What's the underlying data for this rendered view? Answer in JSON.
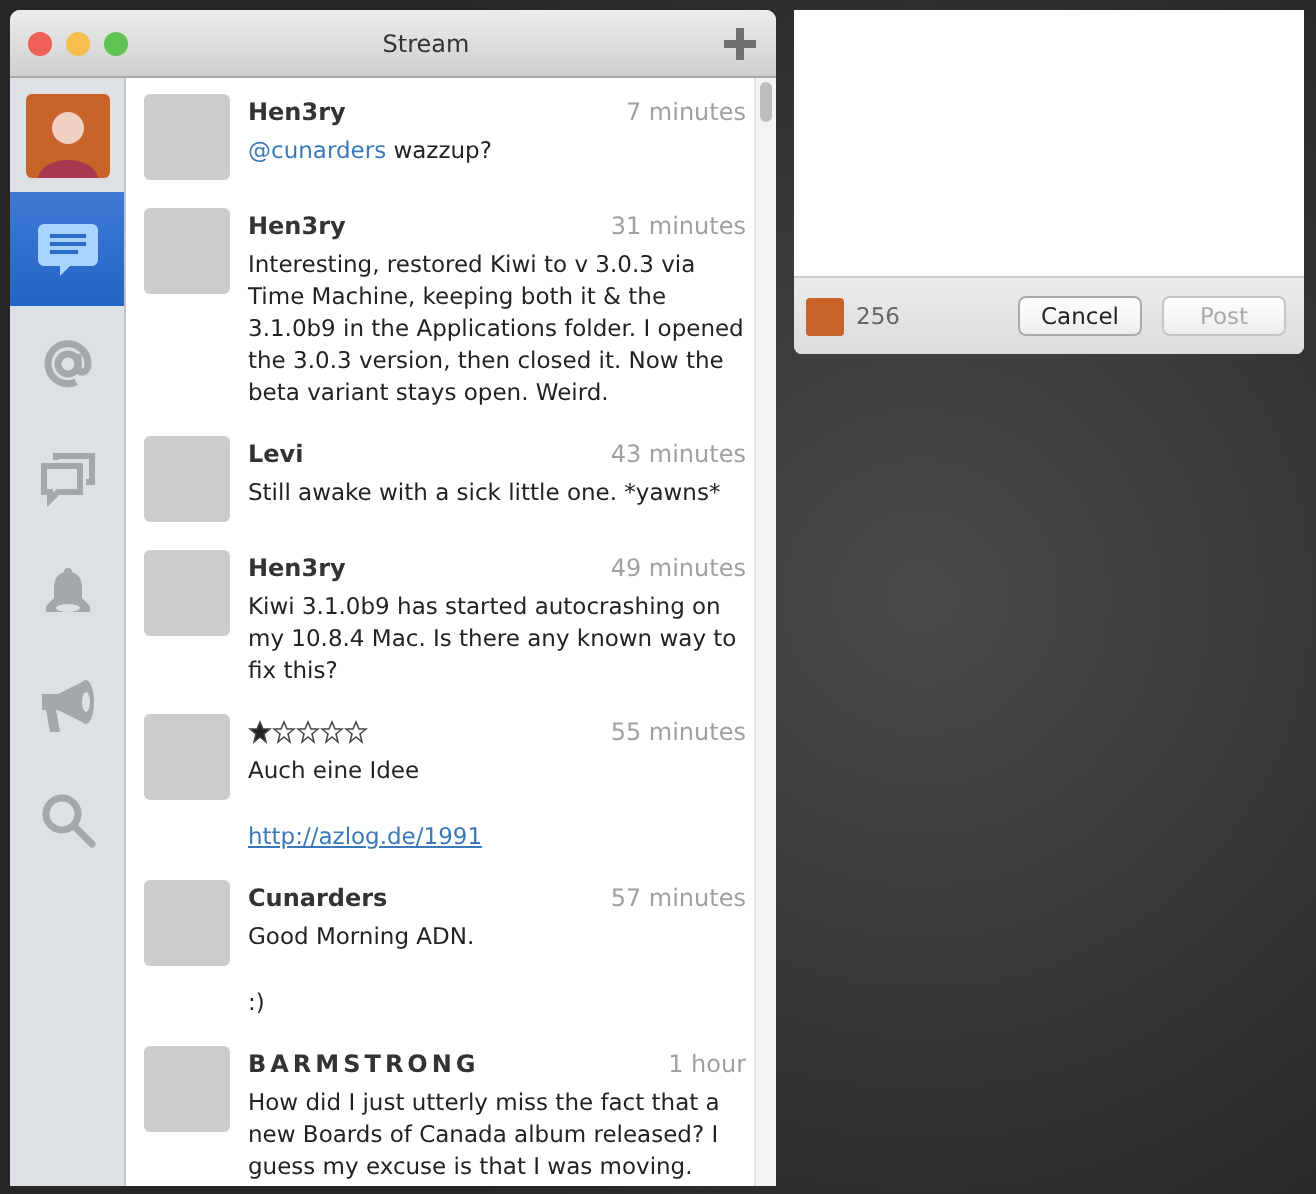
{
  "window": {
    "title": "Stream"
  },
  "sidebar": {
    "items": [
      {
        "kind": "profile",
        "selected": false
      },
      {
        "kind": "stream",
        "selected": true
      },
      {
        "kind": "mentions",
        "selected": false
      },
      {
        "kind": "messages",
        "selected": false
      },
      {
        "kind": "notifications",
        "selected": false
      },
      {
        "kind": "broadcast",
        "selected": false
      },
      {
        "kind": "search",
        "selected": false
      }
    ]
  },
  "posts": [
    {
      "kind": "name",
      "author": "Hen3ry",
      "time": "7 minutes",
      "paragraphs": [
        [
          {
            "kind": "mention",
            "text": "@cunarders"
          },
          {
            "kind": "text",
            "text": " wazzup?"
          }
        ]
      ]
    },
    {
      "kind": "name",
      "author": "Hen3ry",
      "time": "31 minutes",
      "paragraphs": [
        [
          {
            "kind": "text",
            "text": "Interesting, restored Kiwi to v 3.0.3 via Time Machine, keeping both it & the 3.1.0b9 in the Applications folder. I opened the 3.0.3 version, then closed it. Now the beta variant stays open. Weird."
          }
        ]
      ]
    },
    {
      "kind": "name",
      "author": "Levi",
      "time": "43 minutes",
      "paragraphs": [
        [
          {
            "kind": "text",
            "text": "Still awake with a sick little one. *yawns*"
          }
        ]
      ]
    },
    {
      "kind": "name",
      "author": "Hen3ry",
      "time": "49 minutes",
      "paragraphs": [
        [
          {
            "kind": "text",
            "text": "Kiwi 3.1.0b9 has started autocrashing on my 10.8.4 Mac. Is there any known way to fix this?"
          }
        ]
      ]
    },
    {
      "kind": "stars",
      "stars": 1,
      "time": "55 minutes",
      "paragraphs": [
        [
          {
            "kind": "text",
            "text": "Auch eine Idee"
          }
        ],
        [
          {
            "kind": "link",
            "text": "http://azlog.de/1991"
          }
        ]
      ]
    },
    {
      "kind": "name",
      "author": "Cunarders",
      "time": "57 minutes",
      "paragraphs": [
        [
          {
            "kind": "text",
            "text": "Good Morning ADN."
          }
        ],
        [
          {
            "kind": "text",
            "text": ":)"
          }
        ]
      ]
    },
    {
      "kind": "spaced",
      "author": "BARMSTRONG",
      "time": "1 hour",
      "paragraphs": [
        [
          {
            "kind": "text",
            "text": "How did I just utterly miss the fact that a new Boards of Canada album released? I guess my excuse is that I was moving."
          }
        ]
      ]
    }
  ],
  "composer": {
    "remaining": "256",
    "buttons": [
      {
        "label": "Cancel",
        "disabled": false
      },
      {
        "label": "Post",
        "disabled": true
      }
    ]
  }
}
